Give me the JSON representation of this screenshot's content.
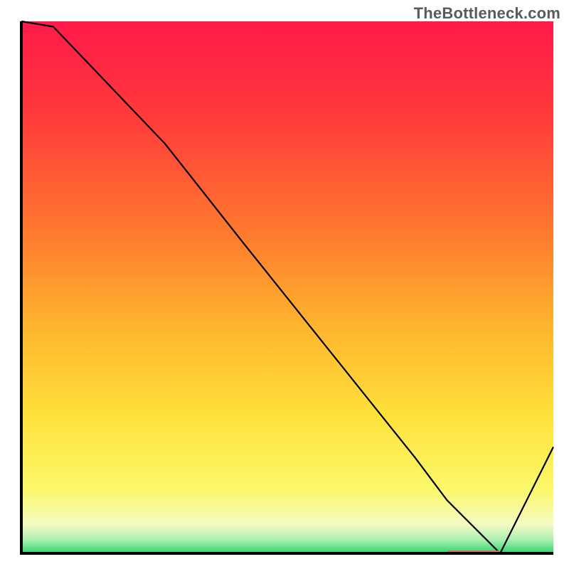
{
  "watermark": "TheBottleneck.com",
  "chart_data": {
    "type": "line",
    "title": "",
    "xlabel": "",
    "ylabel": "",
    "xlim": [
      0,
      100
    ],
    "ylim": [
      0,
      100
    ],
    "x": [
      0,
      6,
      27,
      42,
      58,
      74,
      80,
      90,
      100
    ],
    "values": [
      100,
      99,
      77,
      58,
      38,
      18,
      10,
      0,
      20
    ],
    "gradient_stops": [
      {
        "offset": 0.0,
        "color": "#ff1a4a"
      },
      {
        "offset": 0.18,
        "color": "#ff3a3a"
      },
      {
        "offset": 0.4,
        "color": "#ff7a2e"
      },
      {
        "offset": 0.58,
        "color": "#ffb72e"
      },
      {
        "offset": 0.74,
        "color": "#ffe13a"
      },
      {
        "offset": 0.88,
        "color": "#fbf86a"
      },
      {
        "offset": 0.945,
        "color": "#f6fbc3"
      },
      {
        "offset": 0.975,
        "color": "#a9f0b0"
      },
      {
        "offset": 1.0,
        "color": "#2dd36f"
      }
    ],
    "marker": {
      "x_start": 80,
      "x_end": 90,
      "y": 0,
      "color": "#e46a60"
    },
    "axis_color": "#000000",
    "line_color": "#000000"
  }
}
